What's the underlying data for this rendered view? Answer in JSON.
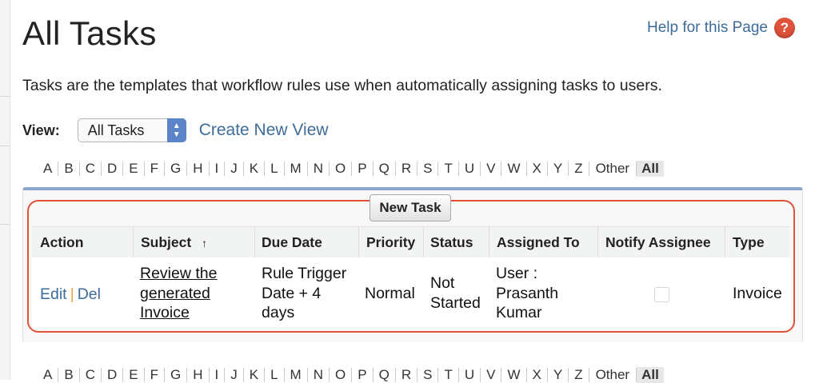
{
  "page": {
    "title": "All Tasks",
    "help_link": "Help for this Page",
    "description": "Tasks are the templates that workflow rules use when automatically assigning tasks to users."
  },
  "view": {
    "label": "View:",
    "selected": "All Tasks",
    "create_link": "Create New View"
  },
  "alphabet": [
    "A",
    "B",
    "C",
    "D",
    "E",
    "F",
    "G",
    "H",
    "I",
    "J",
    "K",
    "L",
    "M",
    "N",
    "O",
    "P",
    "Q",
    "R",
    "S",
    "T",
    "U",
    "V",
    "W",
    "X",
    "Y",
    "Z",
    "Other",
    "All"
  ],
  "table": {
    "new_button": "New Task",
    "headers": {
      "action": "Action",
      "subject": "Subject",
      "sort_indicator": "↑",
      "due_date": "Due Date",
      "priority": "Priority",
      "status": "Status",
      "assigned_to": "Assigned To",
      "notify": "Notify Assignee",
      "type": "Type"
    },
    "rows": [
      {
        "edit": "Edit",
        "separator": "|",
        "del": "Del",
        "subject": [
          "Review the",
          "generated",
          "Invoice"
        ],
        "due_date": [
          "Rule Trigger",
          "Date + 4",
          "days"
        ],
        "priority": "Normal",
        "status": [
          "Not",
          "Started"
        ],
        "assigned_to": [
          "User :",
          "Prasanth",
          "Kumar"
        ],
        "notify_checked": false,
        "type": "Invoice"
      }
    ]
  },
  "colors": {
    "link": "#3d6c99",
    "highlight": "#e0533a",
    "panel_top": "#8aa6c9"
  }
}
